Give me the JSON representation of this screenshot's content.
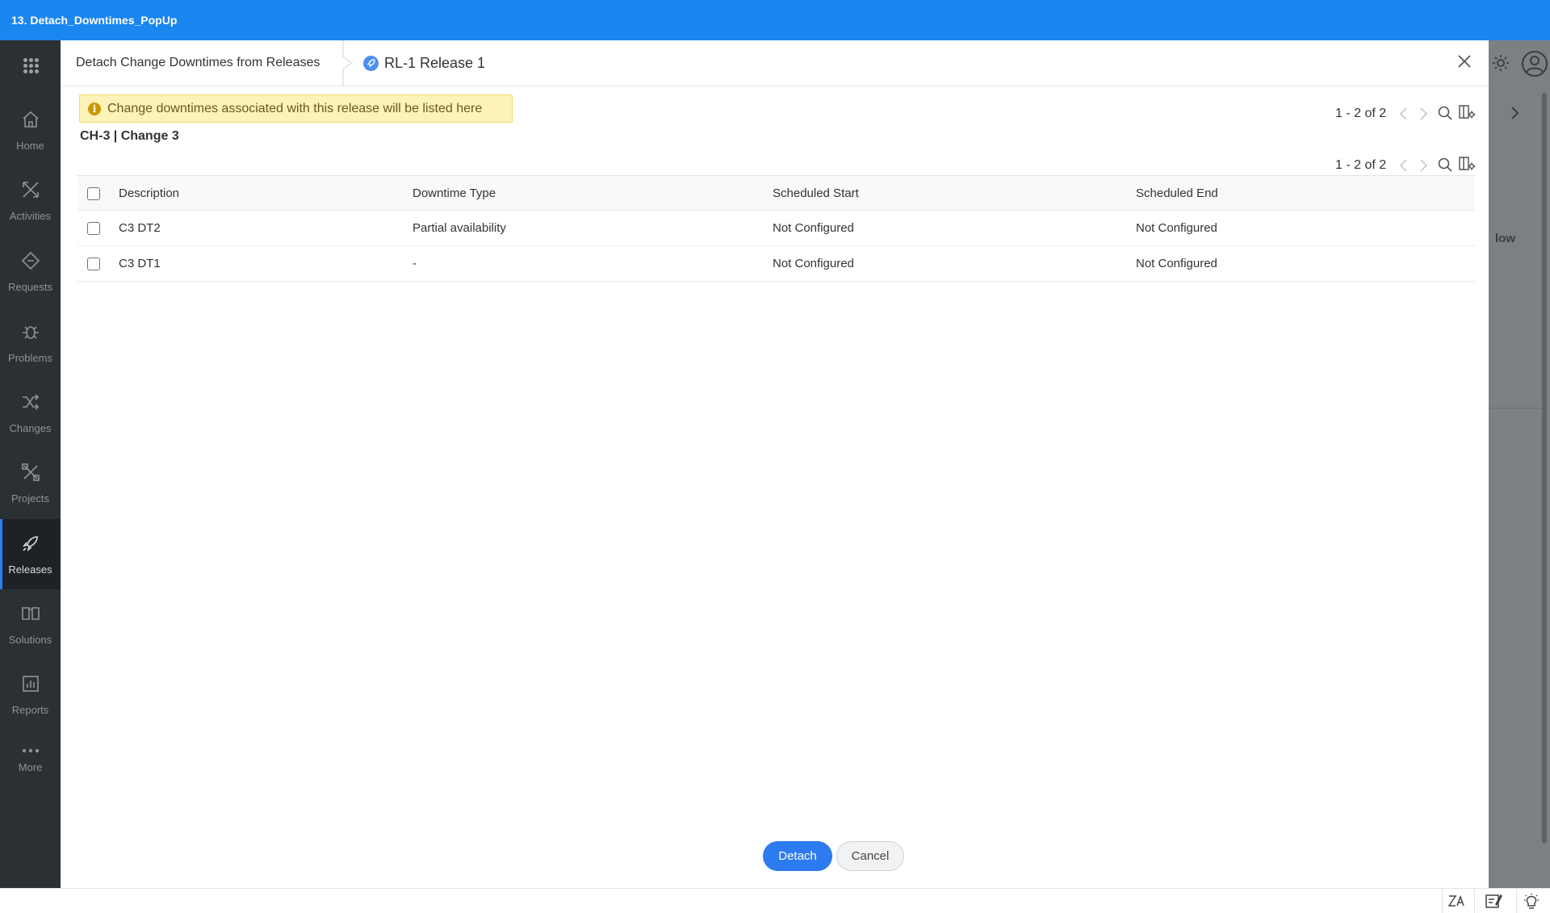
{
  "window": {
    "title": "13. Detach_Downtimes_PopUp"
  },
  "sidebar": {
    "items": [
      {
        "label": "Home",
        "icon": "home-icon"
      },
      {
        "label": "Activities",
        "icon": "activities-icon"
      },
      {
        "label": "Requests",
        "icon": "requests-icon"
      },
      {
        "label": "Problems",
        "icon": "problems-icon"
      },
      {
        "label": "Changes",
        "icon": "changes-icon"
      },
      {
        "label": "Projects",
        "icon": "projects-icon"
      },
      {
        "label": "Releases",
        "icon": "releases-icon",
        "active": true
      },
      {
        "label": "Solutions",
        "icon": "solutions-icon"
      },
      {
        "label": "Reports",
        "icon": "reports-icon"
      },
      {
        "label": "More",
        "icon": "more-icon"
      }
    ]
  },
  "background": {
    "partial_text": "low"
  },
  "modal": {
    "title": "Detach Change Downtimes from Releases",
    "release_label": "RL-1 Release 1",
    "info_message": "Change downtimes associated with this release will be listed here",
    "outer_pager": {
      "count": "1 - 2 of 2"
    },
    "change_title": "CH-3 | Change 3",
    "inner_pager": {
      "count": "1 - 2 of 2"
    },
    "table": {
      "columns": [
        "Description",
        "Downtime Type",
        "Scheduled Start",
        "Scheduled End"
      ],
      "rows": [
        {
          "description": "C3 DT2",
          "downtime_type": "Partial availability",
          "scheduled_start": "Not Configured",
          "scheduled_end": "Not Configured"
        },
        {
          "description": "C3 DT1",
          "downtime_type": "-",
          "scheduled_start": "Not Configured",
          "scheduled_end": "Not Configured"
        }
      ]
    },
    "buttons": {
      "detach": "Detach",
      "cancel": "Cancel"
    }
  },
  "colors": {
    "topbar": "#1a86f0",
    "primary": "#2d7bf0",
    "sidebar": "#2b3034",
    "info_bg": "#fdf2b8"
  }
}
